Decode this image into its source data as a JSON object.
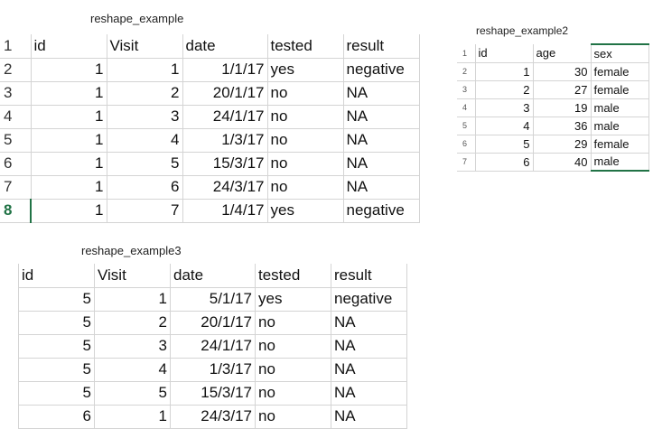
{
  "sheet1": {
    "caption": "reshape_example",
    "header": {
      "row_label": "1",
      "cells": [
        "id",
        "Visit",
        "date",
        "tested",
        "result"
      ]
    },
    "rows": [
      {
        "row_label": "2",
        "cells": [
          "1",
          "1",
          "1/1/17",
          "yes",
          "negative"
        ]
      },
      {
        "row_label": "3",
        "cells": [
          "1",
          "2",
          "20/1/17",
          "no",
          "NA"
        ]
      },
      {
        "row_label": "4",
        "cells": [
          "1",
          "3",
          "24/1/17",
          "no",
          "NA"
        ]
      },
      {
        "row_label": "5",
        "cells": [
          "1",
          "4",
          "1/3/17",
          "no",
          "NA"
        ]
      },
      {
        "row_label": "6",
        "cells": [
          "1",
          "5",
          "15/3/17",
          "no",
          "NA"
        ]
      },
      {
        "row_label": "7",
        "cells": [
          "1",
          "6",
          "24/3/17",
          "no",
          "NA"
        ]
      },
      {
        "row_label": "8",
        "cells": [
          "1",
          "7",
          "1/4/17",
          "yes",
          "negative"
        ]
      }
    ]
  },
  "sheet2": {
    "caption": "reshape_example2",
    "header": {
      "row_label": "1",
      "cells": [
        "id",
        "age",
        "sex"
      ]
    },
    "rows": [
      {
        "row_label": "2",
        "cells": [
          "1",
          "30",
          "female"
        ]
      },
      {
        "row_label": "3",
        "cells": [
          "2",
          "27",
          "female"
        ]
      },
      {
        "row_label": "4",
        "cells": [
          "3",
          "19",
          "male"
        ]
      },
      {
        "row_label": "5",
        "cells": [
          "4",
          "36",
          "male"
        ]
      },
      {
        "row_label": "6",
        "cells": [
          "5",
          "29",
          "female"
        ]
      },
      {
        "row_label": "7",
        "cells": [
          "6",
          "40",
          "male"
        ]
      }
    ]
  },
  "sheet3": {
    "caption": "reshape_example3",
    "header": {
      "cells": [
        "id",
        "Visit",
        "date",
        "tested",
        "result"
      ]
    },
    "rows": [
      {
        "cells": [
          "5",
          "1",
          "5/1/17",
          "yes",
          "negative"
        ]
      },
      {
        "cells": [
          "5",
          "2",
          "20/1/17",
          "no",
          "NA"
        ]
      },
      {
        "cells": [
          "5",
          "3",
          "24/1/17",
          "no",
          "NA"
        ]
      },
      {
        "cells": [
          "5",
          "4",
          "1/3/17",
          "no",
          "NA"
        ]
      },
      {
        "cells": [
          "5",
          "5",
          "15/3/17",
          "no",
          "NA"
        ]
      },
      {
        "cells": [
          "6",
          "1",
          "24/3/17",
          "no",
          "NA"
        ]
      }
    ]
  },
  "colors": {
    "excel_green": "#217346",
    "grid": "#d4d4d4"
  }
}
